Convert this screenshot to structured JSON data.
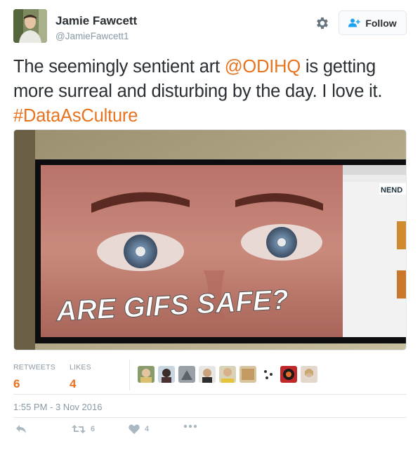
{
  "author": {
    "name": "Jamie Fawcett",
    "handle": "@JamieFawcett1"
  },
  "follow_label": "Follow",
  "tweet": {
    "text_before": "The seemingly sentient art ",
    "mention": "@ODIHQ",
    "text_after": " is getting more surreal and disturbing by the day. I love it. ",
    "hashtag": "#DataAsCulture"
  },
  "media": {
    "caption_on_screen": "ARE GIFS SAFE?",
    "browser_brand": "NEND"
  },
  "stats": {
    "retweets_label": "RETWEETS",
    "retweets_count": "6",
    "likes_label": "LIKES",
    "likes_count": "4"
  },
  "timestamp": "1:55 PM - 3 Nov 2016",
  "actions": {
    "retweet_count": "6",
    "like_count": "4"
  },
  "colors": {
    "accent": "#e8731f",
    "muted": "#8899a6",
    "text": "#292f33"
  }
}
